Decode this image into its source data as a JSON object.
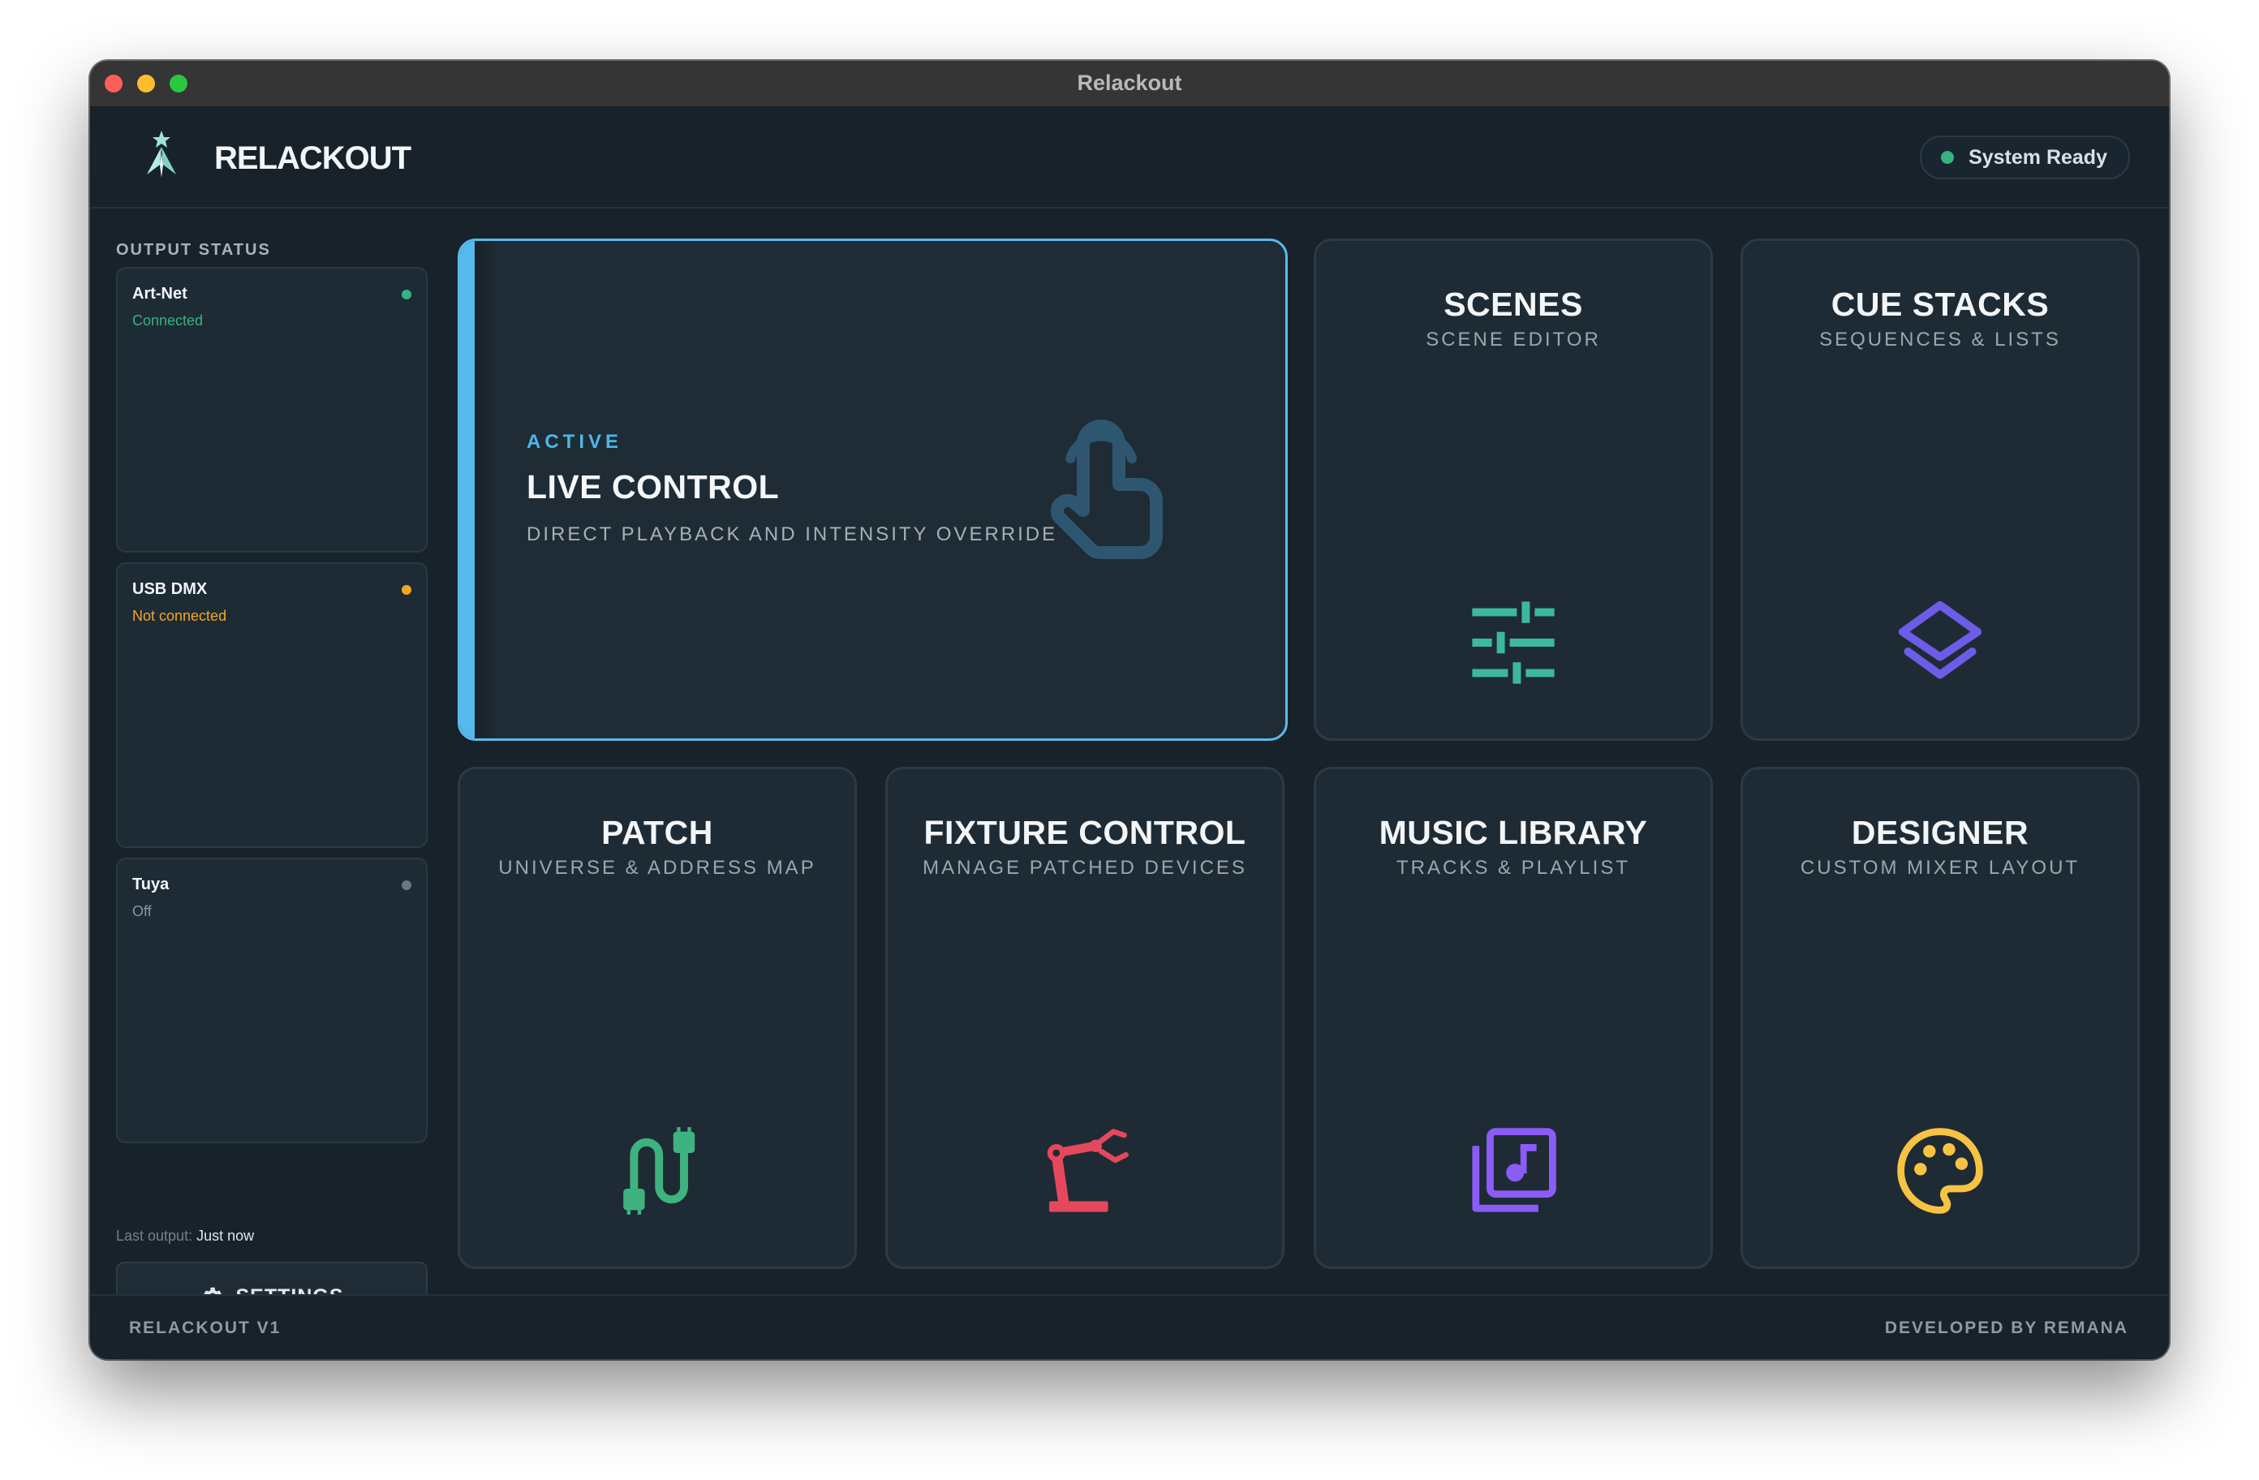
{
  "window": {
    "title": "Relackout"
  },
  "header": {
    "app_name": "RELACKOUT",
    "status": {
      "label": "System Ready",
      "color": "#36b37e"
    }
  },
  "sidebar": {
    "title": "OUTPUT STATUS",
    "outputs": [
      {
        "name": "Art-Net",
        "state": "Connected",
        "color": "#36b37e"
      },
      {
        "name": "USB DMX",
        "state": "Not connected",
        "color": "#f5a623"
      },
      {
        "name": "Tuya",
        "state": "Off",
        "color": "#6b7782"
      }
    ],
    "last_output_label": "Last output:",
    "last_output_value": "Just now",
    "settings_label": "SETTINGS"
  },
  "live_control": {
    "badge": "ACTIVE",
    "title": "LIVE CONTROL",
    "subtitle": "DIRECT PLAYBACK AND INTENSITY OVERRIDE",
    "icon": "hand-pointer-icon",
    "accent": "#55b9ee"
  },
  "tiles": [
    {
      "id": "scenes",
      "title": "SCENES",
      "subtitle": "SCENE EDITOR",
      "icon": "sliders-icon",
      "color": "#3db8a0"
    },
    {
      "id": "cue-stacks",
      "title": "CUE STACKS",
      "subtitle": "SEQUENCES & LISTS",
      "icon": "layers-icon",
      "color": "#6c5ce7"
    },
    {
      "id": "patch",
      "title": "PATCH",
      "subtitle": "UNIVERSE & ADDRESS MAP",
      "icon": "cable-icon",
      "color": "#3fb37f"
    },
    {
      "id": "fixture-control",
      "title": "FIXTURE CONTROL",
      "subtitle": "MANAGE PATCHED DEVICES",
      "icon": "robot-arm-icon",
      "color": "#e5485d"
    },
    {
      "id": "music-library",
      "title": "MUSIC LIBRARY",
      "subtitle": "TRACKS & PLAYLIST",
      "icon": "music-library-icon",
      "color": "#8b5cf6"
    },
    {
      "id": "designer",
      "title": "DESIGNER",
      "subtitle": "CUSTOM MIXER LAYOUT",
      "icon": "palette-icon",
      "color": "#f6c343"
    }
  ],
  "footer": {
    "version": "RELACKOUT V1",
    "credit": "DEVELOPED BY REMANA"
  }
}
